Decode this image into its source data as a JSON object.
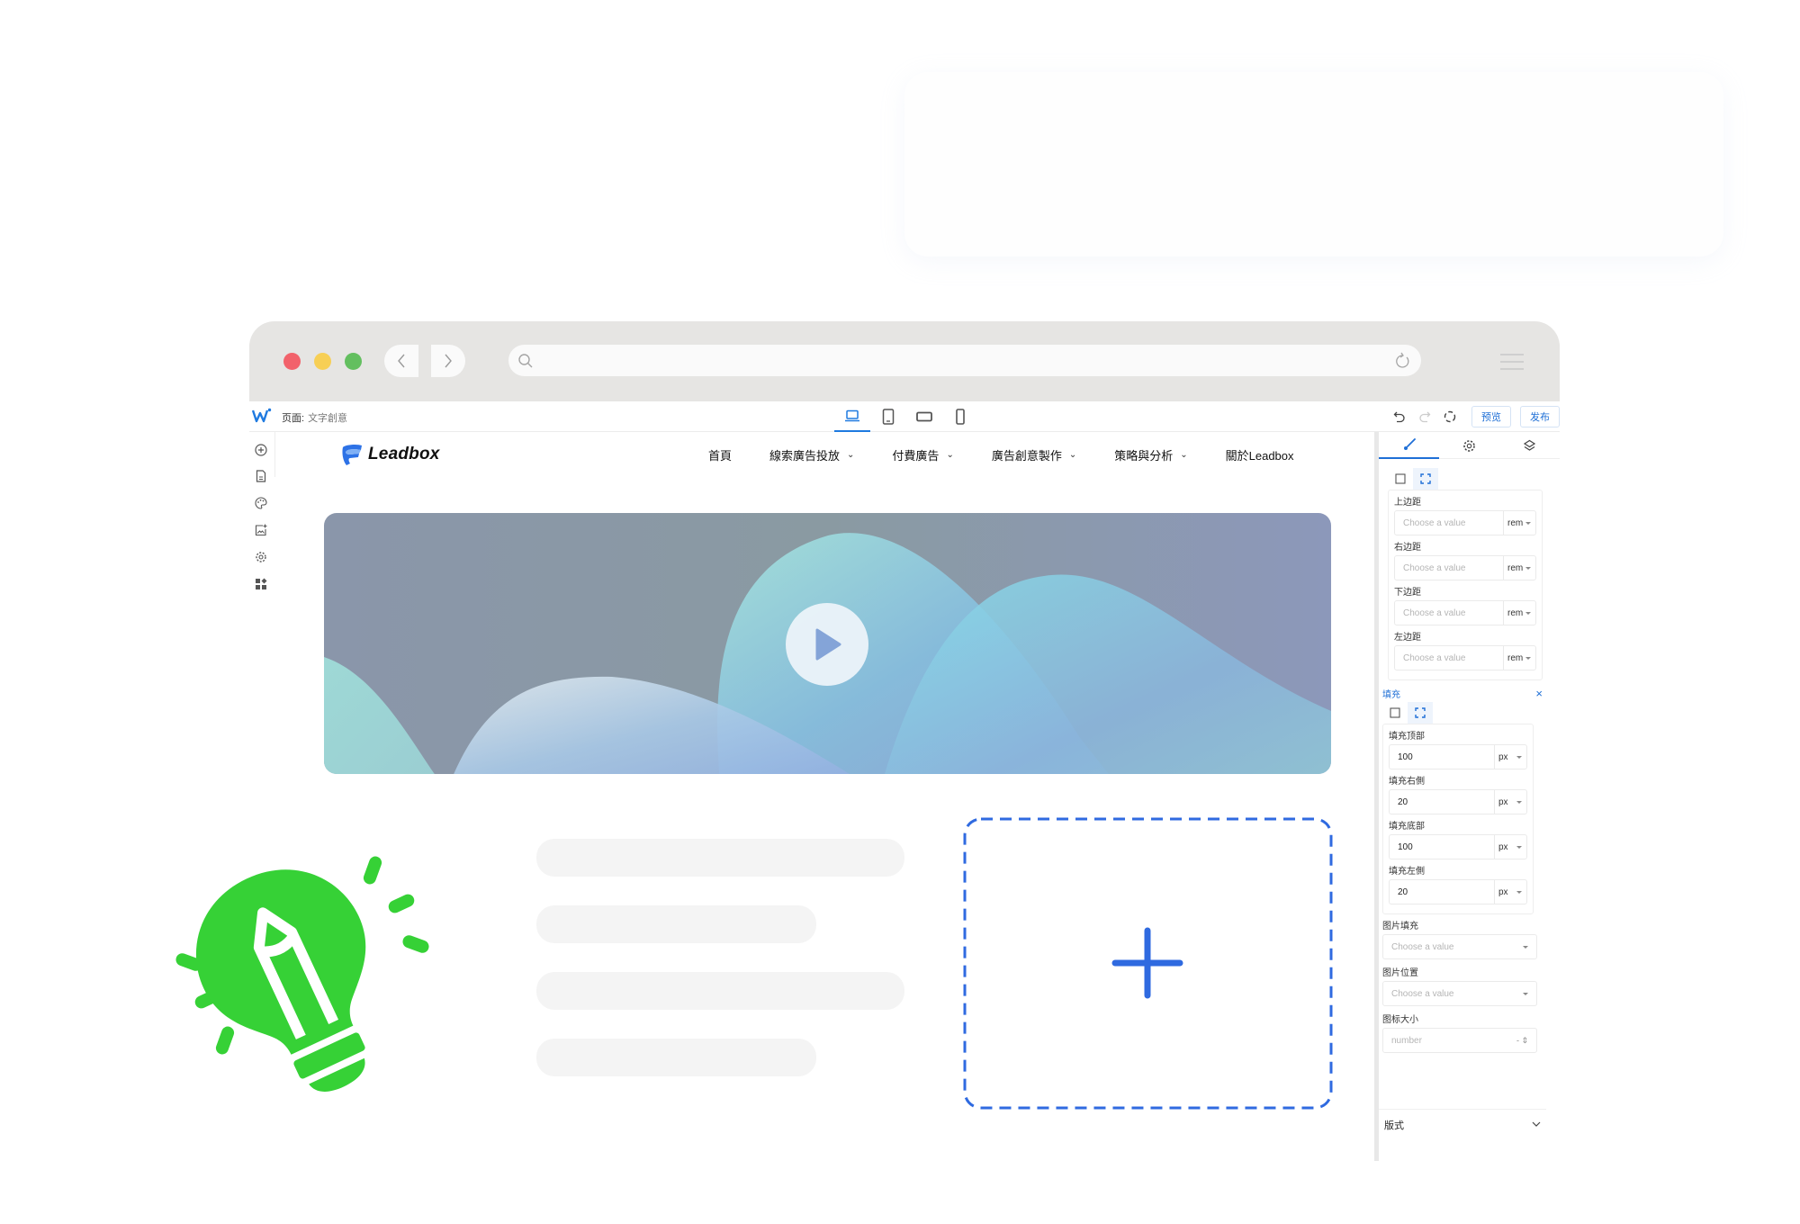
{
  "browser": {
    "traffic_lights": [
      "close",
      "minimize",
      "maximize"
    ],
    "url_value": "",
    "icons": [
      "back-icon",
      "forward-icon",
      "search-icon",
      "reload-icon",
      "menu-icon"
    ]
  },
  "editor": {
    "page_label": "页面:",
    "page_name": "文字創意",
    "devices": [
      {
        "name": "desktop",
        "active": true
      },
      {
        "name": "tablet",
        "active": false
      },
      {
        "name": "tablet-landscape",
        "active": false
      },
      {
        "name": "mobile",
        "active": false
      }
    ],
    "preview_label": "预览",
    "publish_label": "发布",
    "rail_icons": [
      "add-icon",
      "page-icon",
      "palette-icon",
      "add-image-icon",
      "settings-icon",
      "widgets-icon"
    ]
  },
  "site": {
    "brand": "Leadbox",
    "nav": [
      {
        "label": "首頁",
        "dropdown": false
      },
      {
        "label": "線索廣告投放",
        "dropdown": true
      },
      {
        "label": "付費廣告",
        "dropdown": true
      },
      {
        "label": "廣告創意製作",
        "dropdown": true
      },
      {
        "label": "策略與分析",
        "dropdown": true
      },
      {
        "label": "關於Leadbox",
        "dropdown": false
      }
    ]
  },
  "panel": {
    "tabs": [
      "style",
      "settings",
      "layers"
    ],
    "margin": {
      "fields": [
        {
          "label": "上边距",
          "placeholder": "Choose a value",
          "unit": "rem"
        },
        {
          "label": "右边距",
          "placeholder": "Choose a value",
          "unit": "rem"
        },
        {
          "label": "下边距",
          "placeholder": "Choose a value",
          "unit": "rem"
        },
        {
          "label": "左边距",
          "placeholder": "Choose a value",
          "unit": "rem"
        }
      ]
    },
    "padding": {
      "title": "填充",
      "close": "×",
      "fields": [
        {
          "label": "填充顶部",
          "value": "100",
          "unit": "px"
        },
        {
          "label": "填充右側",
          "value": "20",
          "unit": "px"
        },
        {
          "label": "填充底部",
          "value": "100",
          "unit": "px"
        },
        {
          "label": "填充左側",
          "value": "20",
          "unit": "px"
        }
      ]
    },
    "image_fill": {
      "label": "图片填充",
      "placeholder": "Choose a value"
    },
    "image_position": {
      "label": "图片位置",
      "placeholder": "Choose a value"
    },
    "icon_size": {
      "label": "图标大小",
      "placeholder": "number"
    },
    "accordion": {
      "label": "版式"
    }
  },
  "colors": {
    "accent": "#1f6fd6",
    "add_box": "#2f6ae0",
    "bulb": "#36d136",
    "chrome": "#e6e5e3"
  }
}
